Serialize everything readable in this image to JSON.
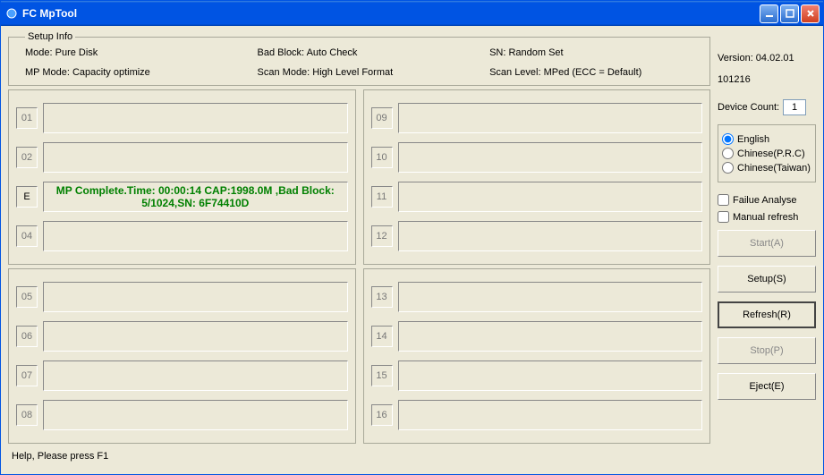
{
  "window": {
    "title": "FC MpTool"
  },
  "setup": {
    "legend": "Setup Info",
    "mode": "Mode: Pure Disk",
    "mp_mode": "MP Mode: Capacity optimize",
    "bad_block": "Bad Block: Auto Check",
    "scan_mode": "Scan Mode: High Level Format",
    "sn": "SN: Random Set",
    "scan_level": "Scan Level: MPed (ECC = Default)"
  },
  "slots": {
    "s01": "01",
    "s02": "02",
    "s03": "E",
    "s04": "04",
    "s05": "05",
    "s06": "06",
    "s07": "07",
    "s08": "08",
    "s09": "09",
    "s10": "10",
    "s11": "11",
    "s12": "12",
    "s13": "13",
    "s14": "14",
    "s15": "15",
    "s16": "16",
    "status03": "MP Complete.Time: 00:00:14 CAP:1998.0M ,Bad Block: 5/1024,SN: 6F74410D"
  },
  "side": {
    "version": "Version: 04.02.01",
    "build": "101216",
    "device_count_label": "Device Count:",
    "device_count": "1",
    "lang_english": "English",
    "lang_prc": "Chinese(P.R.C)",
    "lang_tw": "Chinese(Taiwan)",
    "failure_analyse": "Failue Analyse",
    "manual_refresh": "Manual refresh",
    "btn_start": "Start(A)",
    "btn_setup": "Setup(S)",
    "btn_refresh": "Refresh(R)",
    "btn_stop": "Stop(P)",
    "btn_eject": "Eject(E)"
  },
  "footer": {
    "help": "Help, Please press F1"
  }
}
